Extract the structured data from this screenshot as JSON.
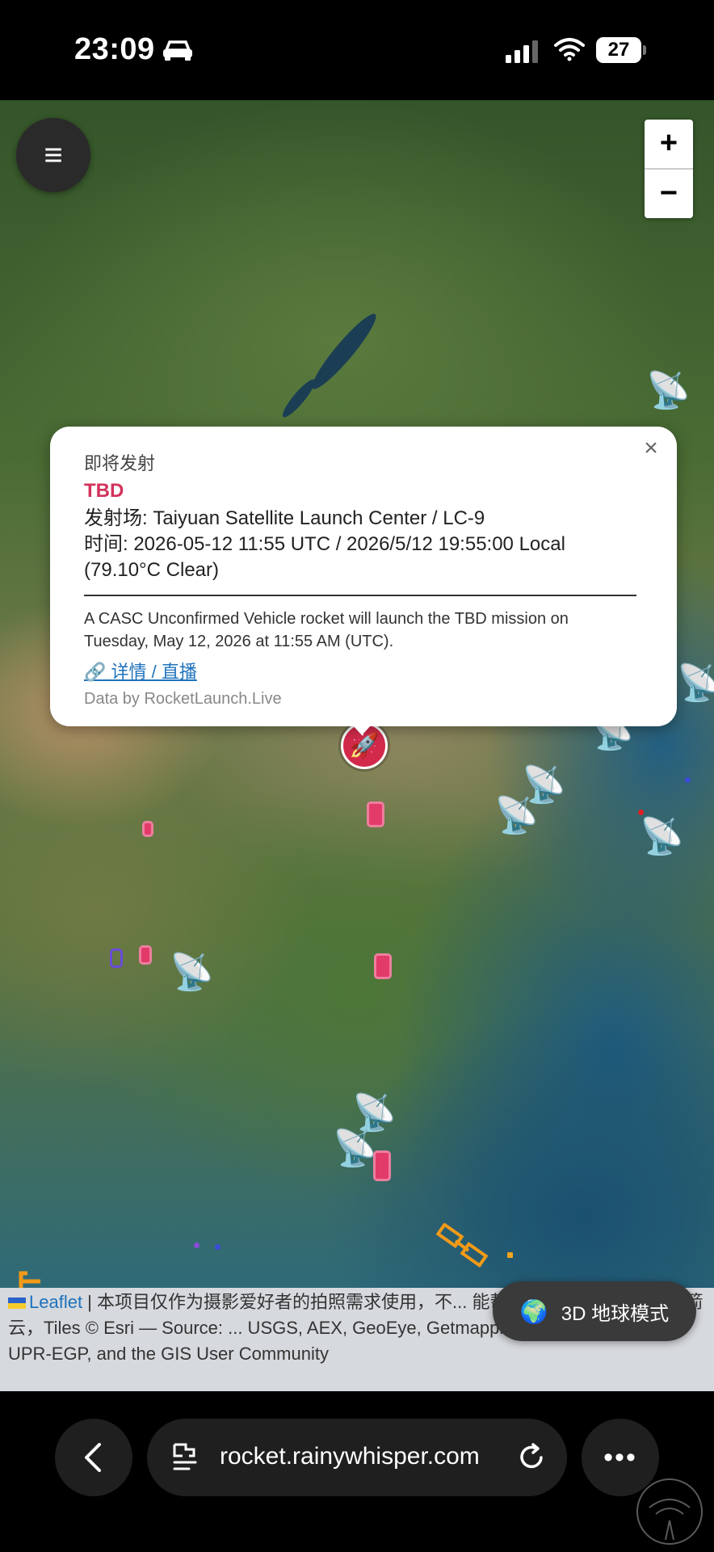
{
  "status_bar": {
    "time": "23:09",
    "battery": "27"
  },
  "map": {
    "zoom_in": "+",
    "zoom_out": "−",
    "menu_icon": "≡"
  },
  "popup": {
    "status": "即将发射",
    "mission": "TBD",
    "site": "发射场: Taiyuan Satellite Launch Center / LC-9",
    "time": "时间: 2026-05-12 11:55 UTC / 2026/5/12 19:55:00 Local",
    "weather": "(79.10°C Clear)",
    "description": "A CASC Unconfirmed Vehicle rocket will launch the TBD mission on Tuesday, May 12, 2026 at 11:55 AM (UTC).",
    "link": "🔗 详情 / 直播",
    "credit": "Data by RocketLaunch.Live",
    "close": "×"
  },
  "attribution": {
    "leaflet": "Leaflet",
    "text": " | 本项目仅作为摄影爱好者的拍照需求使用，不... 能帮助大家拍摄到壮观的火箭云，Tiles © Esri — Source: ... USGS, AEX, GeoEye, Getmapping, Aerogrid, IGN, IGP, UPR-EGP, and the GIS User Community"
  },
  "globe_button": {
    "label": "3D 地球模式",
    "icon": "🌍"
  },
  "browser": {
    "url": "rocket.rainywhisper.com",
    "more": "•••"
  }
}
